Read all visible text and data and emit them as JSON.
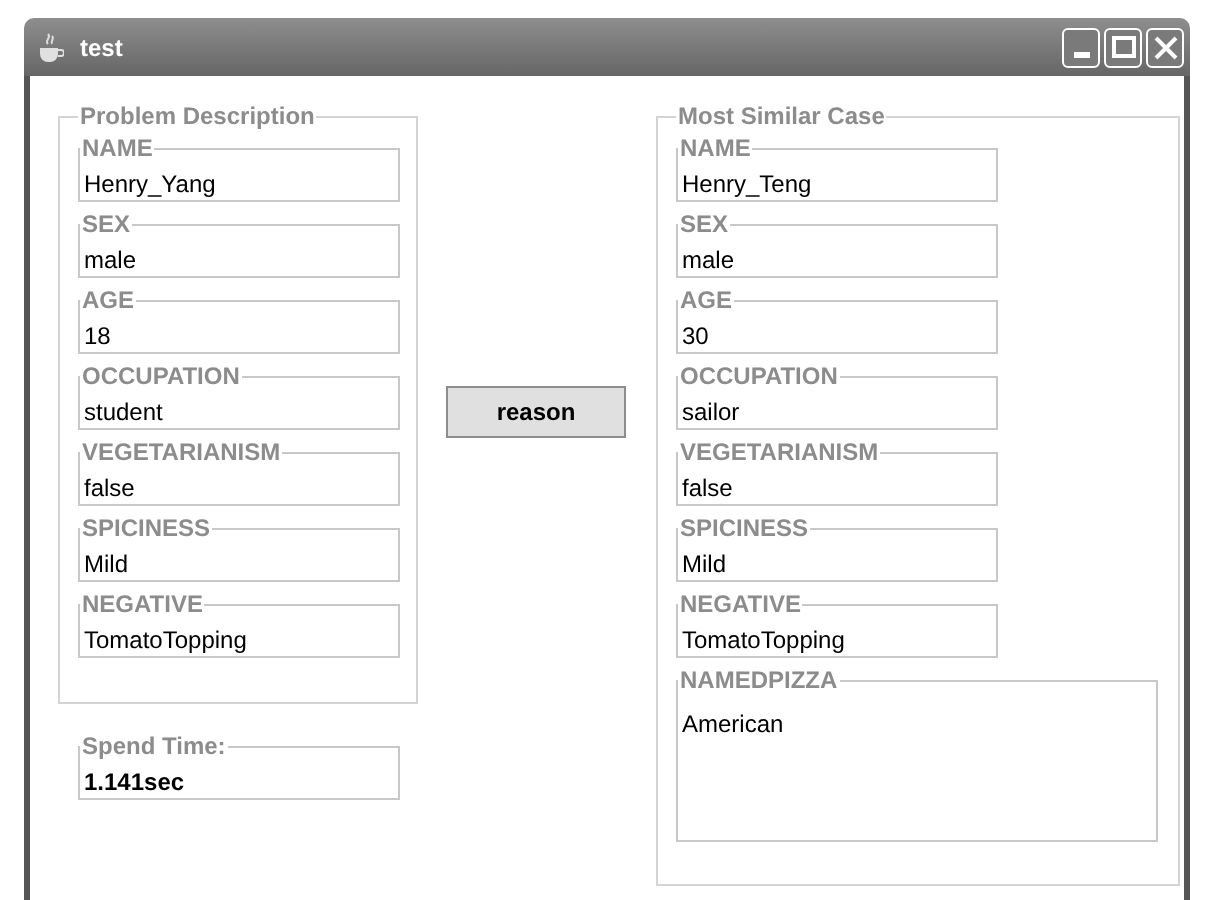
{
  "window": {
    "title": "test"
  },
  "problem": {
    "title": "Problem Description",
    "fields": [
      {
        "label": "NAME",
        "value": "Henry_Yang"
      },
      {
        "label": "SEX",
        "value": "male"
      },
      {
        "label": "AGE",
        "value": "18"
      },
      {
        "label": "OCCUPATION",
        "value": "student"
      },
      {
        "label": "VEGETARIANISM",
        "value": "false"
      },
      {
        "label": "SPICINESS",
        "value": "Mild"
      },
      {
        "label": "NEGATIVE",
        "value": "TomatoTopping"
      }
    ]
  },
  "spend_time": {
    "label": "Spend Time:",
    "value": "1.141sec"
  },
  "reason_button": {
    "label": "reason"
  },
  "similar": {
    "title": "Most Similar Case",
    "fields": [
      {
        "label": "NAME",
        "value": "Henry_Teng",
        "kind": "line"
      },
      {
        "label": "SEX",
        "value": "male",
        "kind": "line"
      },
      {
        "label": "AGE",
        "value": "30",
        "kind": "line"
      },
      {
        "label": "OCCUPATION",
        "value": "sailor",
        "kind": "line"
      },
      {
        "label": "VEGETARIANISM",
        "value": "false",
        "kind": "line"
      },
      {
        "label": "SPICINESS",
        "value": "Mild",
        "kind": "line"
      },
      {
        "label": "NEGATIVE",
        "value": "TomatoTopping",
        "kind": "line"
      },
      {
        "label": "NAMEDPIZZA",
        "value": "American",
        "kind": "area"
      }
    ]
  }
}
